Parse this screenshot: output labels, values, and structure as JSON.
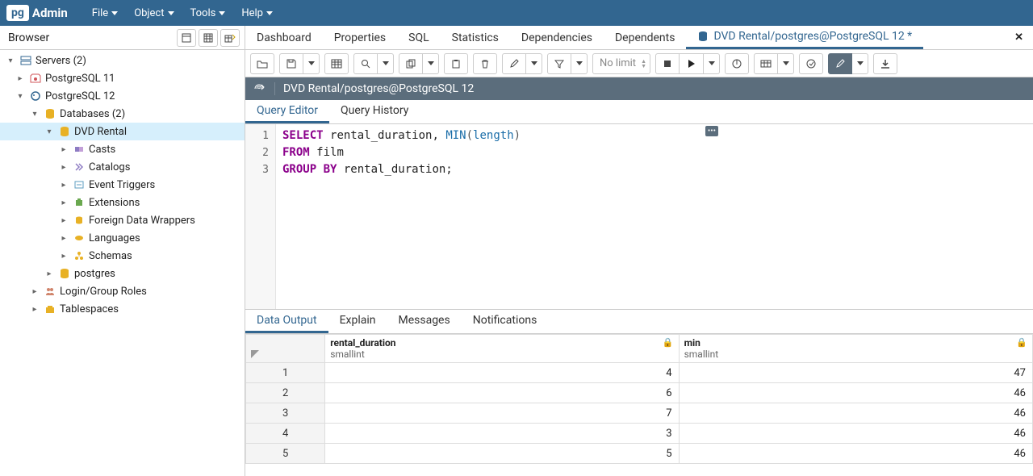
{
  "app": {
    "logo_pg": "pg",
    "logo_admin": "Admin"
  },
  "menubar": {
    "items": [
      "File",
      "Object",
      "Tools",
      "Help"
    ]
  },
  "browser": {
    "title": "Browser"
  },
  "tree": {
    "servers": "Servers (2)",
    "pg11": "PostgreSQL 11",
    "pg12": "PostgreSQL 12",
    "databases": "Databases (2)",
    "dvd": "DVD Rental",
    "casts": "Casts",
    "catalogs": "Catalogs",
    "event_triggers": "Event Triggers",
    "extensions": "Extensions",
    "fdw": "Foreign Data Wrappers",
    "languages": "Languages",
    "schemas": "Schemas",
    "postgres": "postgres",
    "roles": "Login/Group Roles",
    "tablespaces": "Tablespaces"
  },
  "tabs": {
    "dashboard": "Dashboard",
    "properties": "Properties",
    "sql": "SQL",
    "statistics": "Statistics",
    "dependencies": "Dependencies",
    "dependents": "Dependents",
    "query": "DVD Rental/postgres@PostgreSQL 12 *"
  },
  "toolbar": {
    "limit": "No limit"
  },
  "connection": {
    "text": "DVD Rental/postgres@PostgreSQL 12"
  },
  "subtabs": {
    "editor": "Query Editor",
    "history": "Query History"
  },
  "editor": {
    "lines": {
      "l1": "1",
      "l2": "2",
      "l3": "3"
    },
    "tokens": {
      "select": "SELECT",
      "rental_duration": "rental_duration",
      "comma": ", ",
      "min": "MIN",
      "lparen": "(",
      "length": "length",
      "rparen": ")",
      "from": "FROM",
      "film": "film",
      "group_by": "GROUP BY",
      "rental_duration2": "rental_duration;",
      "space": " "
    },
    "scratch": "•••"
  },
  "result_tabs": {
    "data": "Data Output",
    "explain": "Explain",
    "messages": "Messages",
    "notifications": "Notifications"
  },
  "columns": [
    {
      "name": "rental_duration",
      "type": "smallint"
    },
    {
      "name": "min",
      "type": "smallint"
    }
  ],
  "rows": [
    {
      "n": "1",
      "rental_duration": "4",
      "min": "47"
    },
    {
      "n": "2",
      "rental_duration": "6",
      "min": "46"
    },
    {
      "n": "3",
      "rental_duration": "7",
      "min": "46"
    },
    {
      "n": "4",
      "rental_duration": "3",
      "min": "46"
    },
    {
      "n": "5",
      "rental_duration": "5",
      "min": "46"
    }
  ]
}
